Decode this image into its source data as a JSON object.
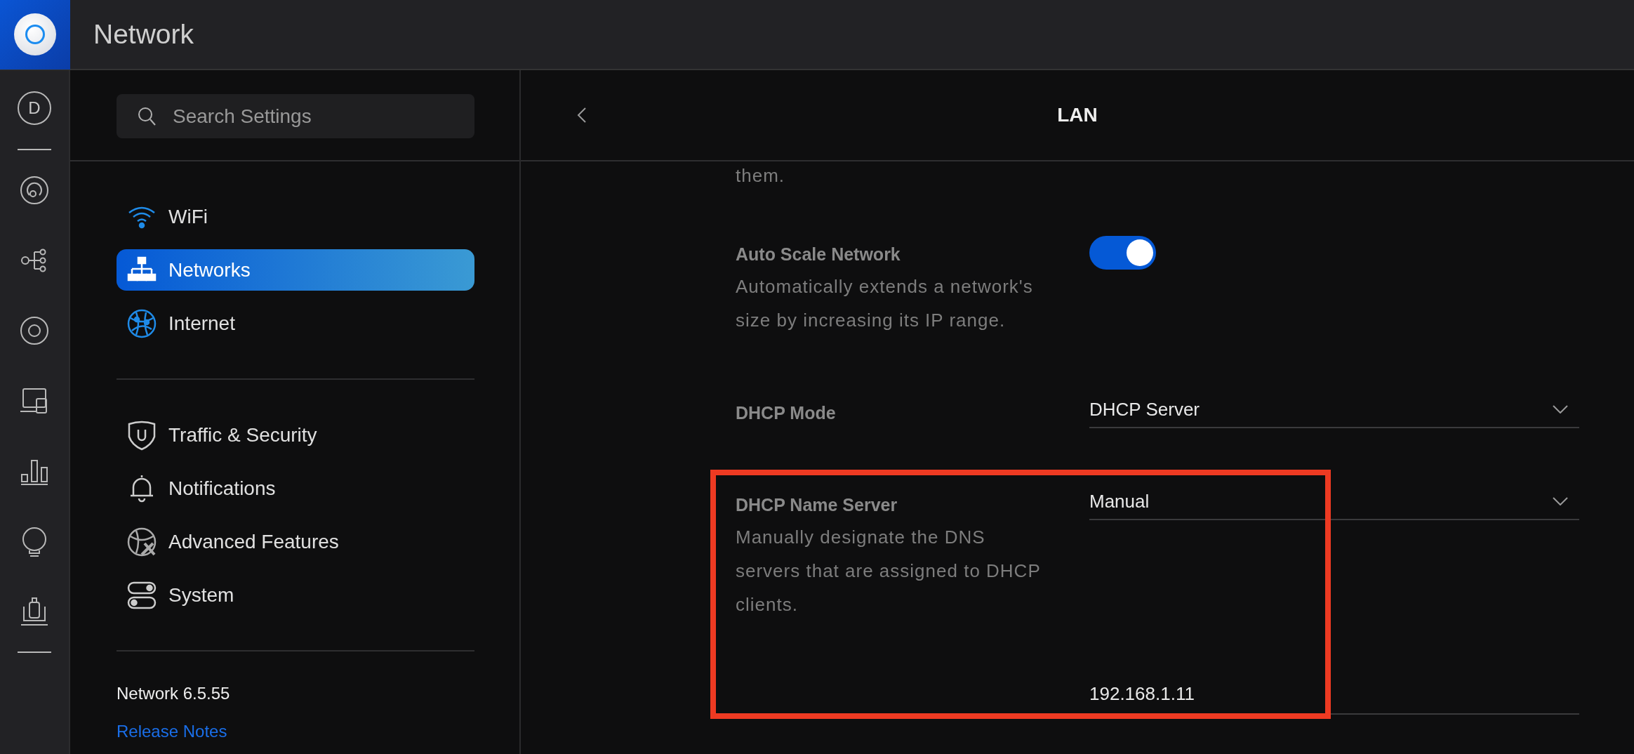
{
  "app": {
    "title": "Network",
    "rail": {
      "avatar_letter": "D"
    }
  },
  "sidebar": {
    "search": {
      "placeholder": "Search Settings"
    },
    "groups": [
      {
        "items": [
          {
            "label": "WiFi",
            "selected": false
          },
          {
            "label": "Networks",
            "selected": true
          },
          {
            "label": "Internet",
            "selected": false
          }
        ]
      },
      {
        "items": [
          {
            "label": "Traffic & Security",
            "selected": false
          },
          {
            "label": "Notifications",
            "selected": false
          },
          {
            "label": "Advanced Features",
            "selected": false
          },
          {
            "label": "System",
            "selected": false
          }
        ]
      }
    ],
    "version": "Network 6.5.55",
    "link": "Release Notes"
  },
  "panel": {
    "title": "LAN",
    "settings": [
      {
        "kind": "text",
        "description": "them."
      },
      {
        "kind": "toggle",
        "label": "Auto Scale Network",
        "description": "Automatically extends a network's size by increasing its IP range.",
        "on": true
      },
      {
        "kind": "select",
        "label": "DHCP Mode",
        "value": "DHCP Server",
        "highlighted": false
      },
      {
        "kind": "select",
        "label": "DHCP Name Server",
        "description": "Manually designate the DNS servers that are assigned to DHCP clients.",
        "value": "Manual",
        "highlighted": true,
        "fields": [
          "192.168.1.11"
        ]
      }
    ]
  }
}
